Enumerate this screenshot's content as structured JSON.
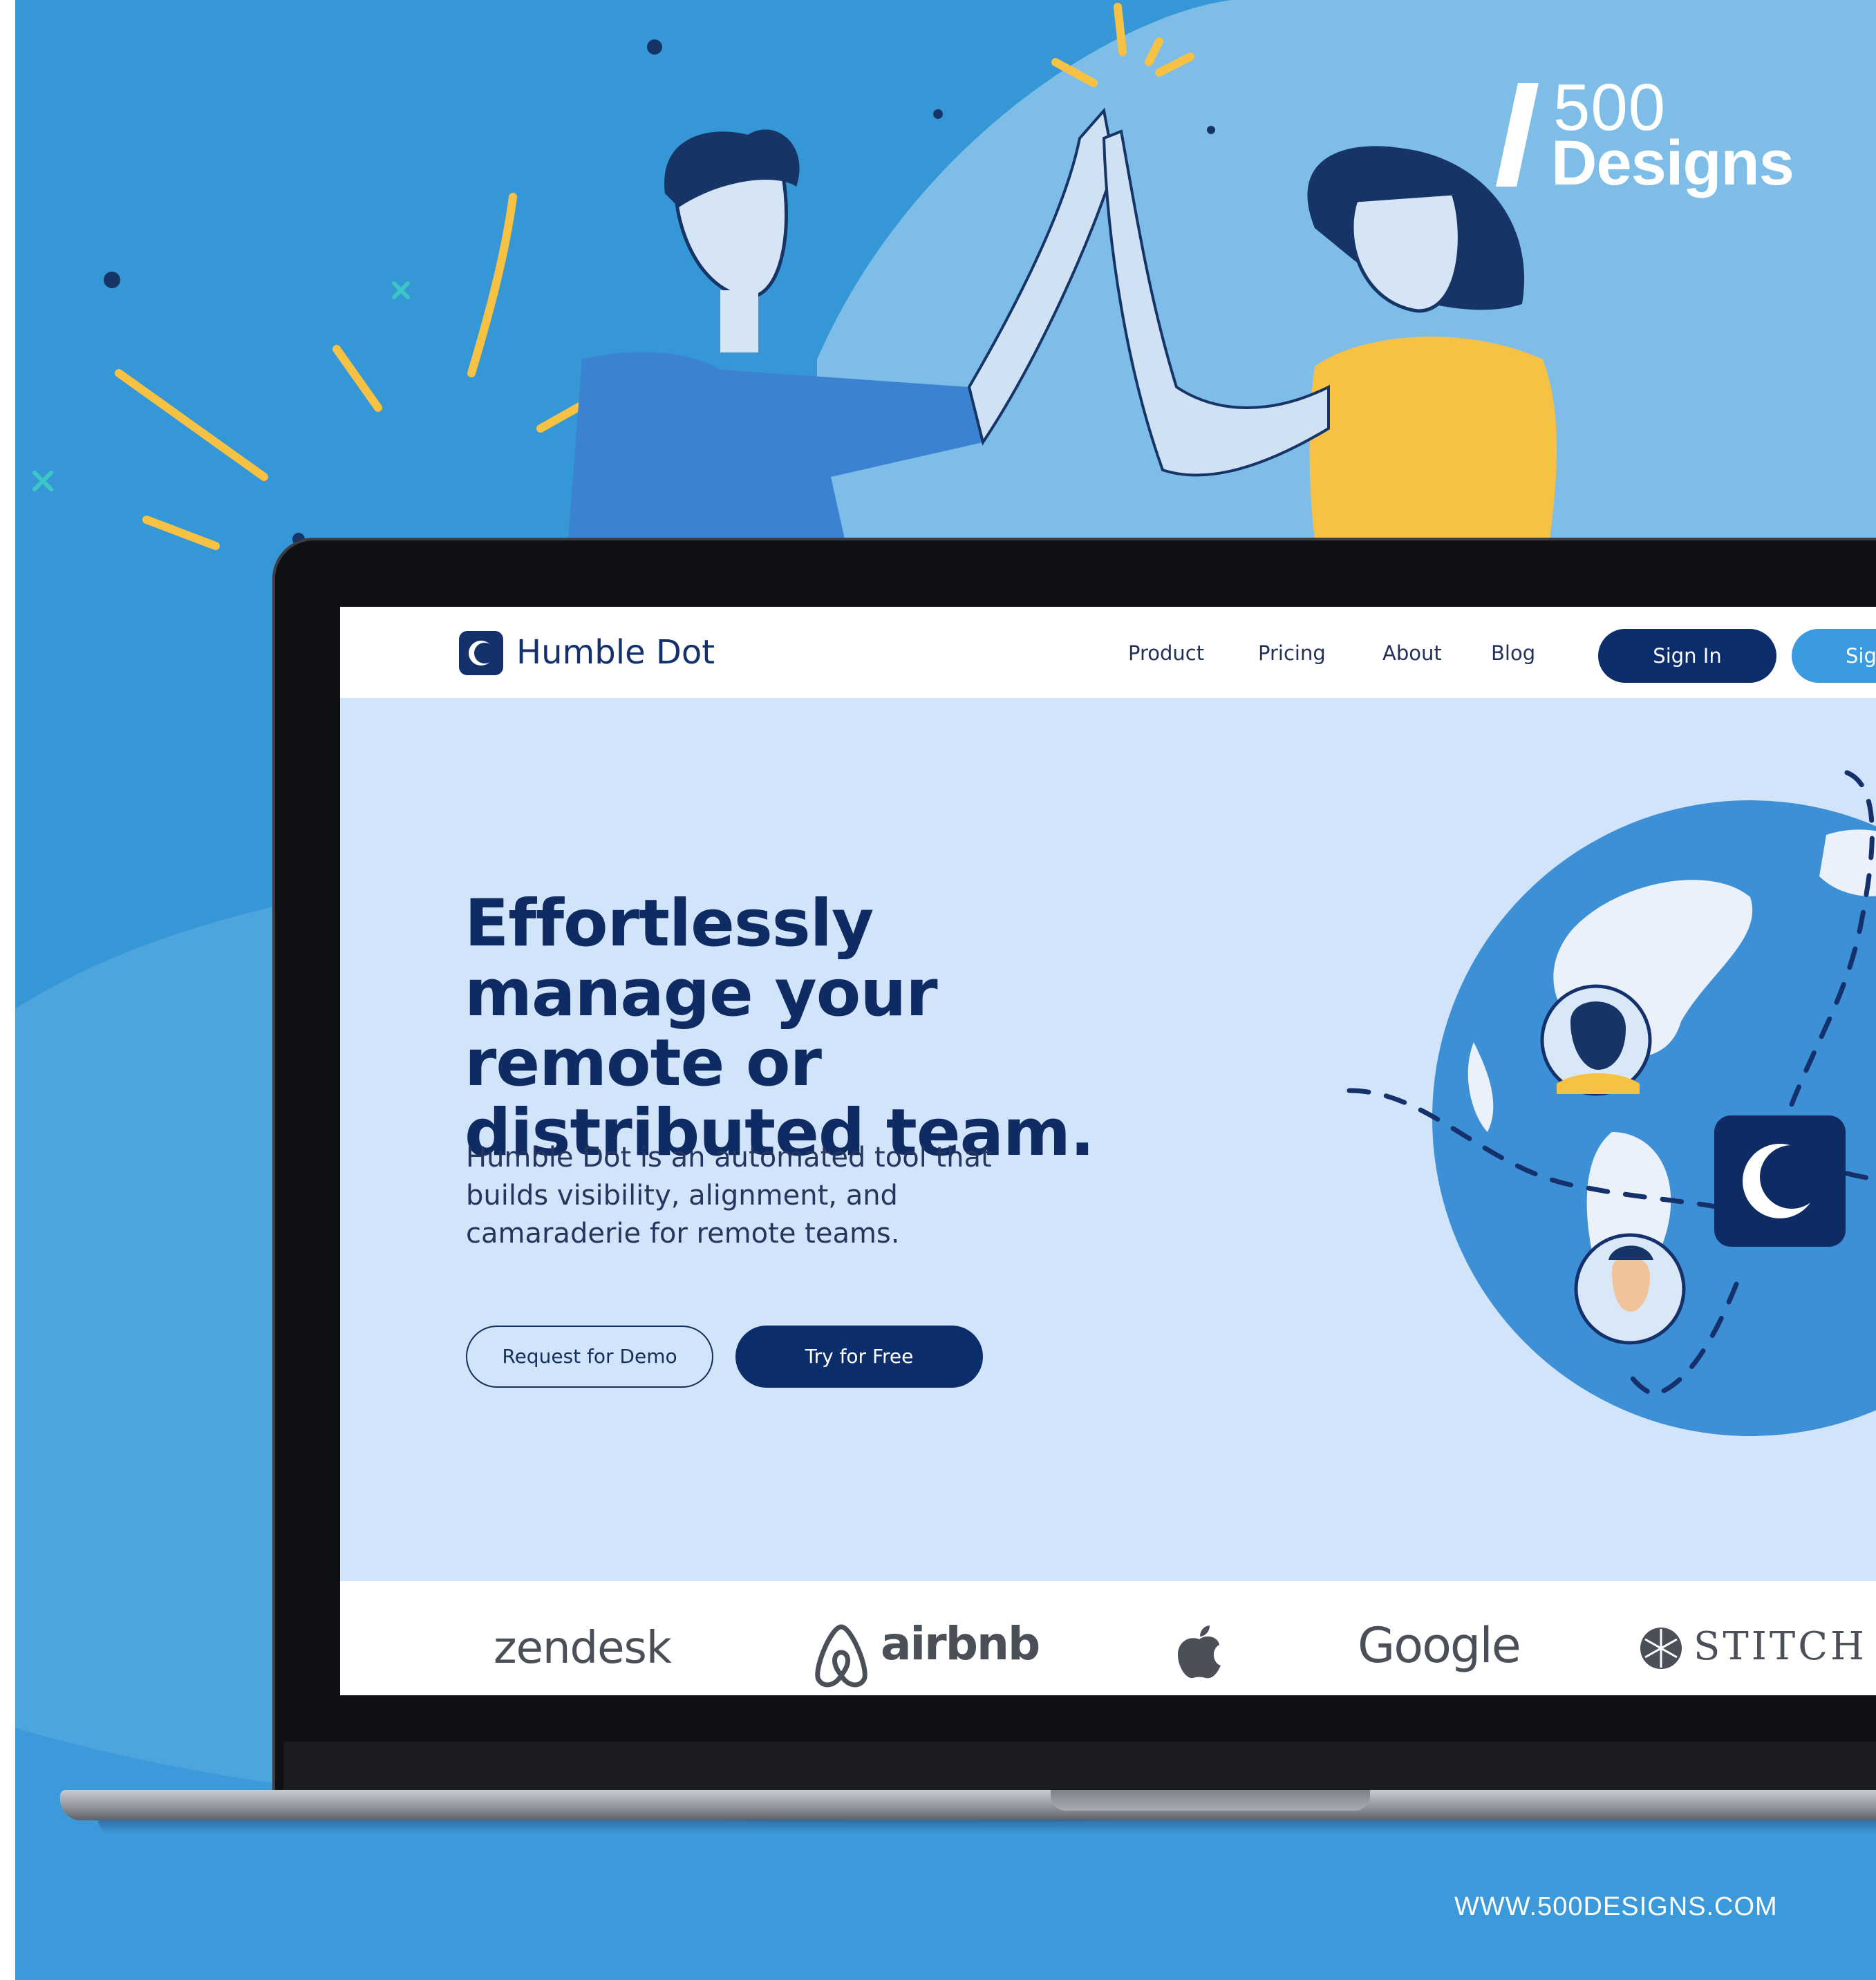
{
  "colors": {
    "background": "#3697d6",
    "navy": "#0c2d6b",
    "screen_bg": "#d1e4f9",
    "accent_blue": "#3b9be0",
    "yellow": "#f7c244"
  },
  "watermark": {
    "line1": "500",
    "line2": "Designs",
    "url": "WWW.500DESIGNS.COM"
  },
  "site": {
    "logo_icon": "moon-dot-icon",
    "brand_name": "Humble Dot",
    "nav": {
      "product": "Product",
      "pricing": "Pricing",
      "about": "About",
      "blog": "Blog",
      "sign_in": "Sign In",
      "sign_up_partial": "Sig"
    },
    "hero": {
      "title": "Effortlessly manage your remote or distributed team.",
      "subtitle": "Humble Dot is an automated tool that builds visibility, alignment, and camaraderie for remote teams.",
      "primary_button": "Try for Free",
      "secondary_button": "Request for Demo"
    },
    "clients": {
      "zendesk": "zendesk",
      "airbnb": "airbnb",
      "apple_icon": "apple-icon",
      "google": "Google",
      "stitch": "STITCH"
    }
  }
}
